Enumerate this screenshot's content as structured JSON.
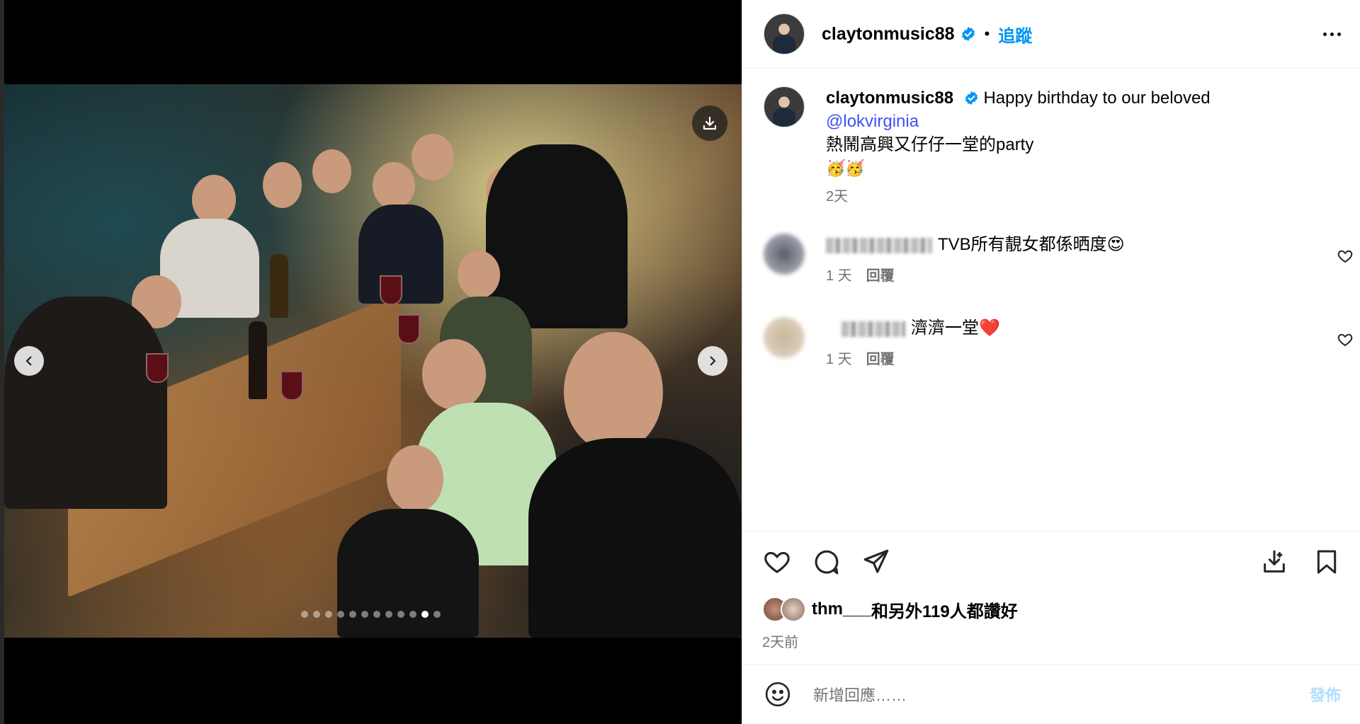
{
  "post": {
    "username": "claytonmusic88",
    "separator": "•",
    "follow_label": "追蹤",
    "caption_text": "Happy birthday to our beloved",
    "mention": "@lokvirginia",
    "caption_line2": "熱鬧高興又仔仔一堂的party",
    "caption_emoji": "🥳🥳",
    "caption_time": "2天"
  },
  "media": {
    "slide_count": 12,
    "active_slide": 11
  },
  "comments": [
    {
      "text": "TVB所有靚女都係晒度😍",
      "time": "1 天",
      "reply_label": "回覆"
    },
    {
      "text": "濟濟一堂❤️",
      "time": "1 天",
      "reply_label": "回覆"
    }
  ],
  "likes": {
    "user": "thm___",
    "rest": "和另外119人都讚好"
  },
  "post_time": "2天前",
  "composer": {
    "placeholder": "新增回應……",
    "post_label": "發佈"
  },
  "colors": {
    "accent": "#0095f6",
    "mention": "#4150f7",
    "muted": "#737373"
  },
  "icons": [
    "verified-badge-icon",
    "more-options-icon",
    "download-icon",
    "chevron-left-icon",
    "chevron-right-icon",
    "heart-icon",
    "comment-icon",
    "share-icon",
    "save-icon",
    "bookmark-icon",
    "emoji-icon"
  ]
}
